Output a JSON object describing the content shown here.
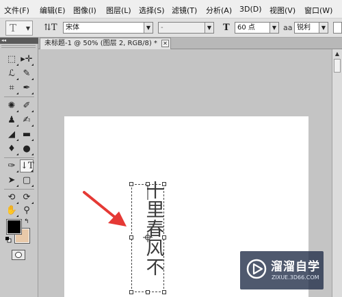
{
  "menu": {
    "items": [
      "文件(F)",
      "编辑(E)",
      "图像(I)",
      "图层(L)",
      "选择(S)",
      "滤镜(T)",
      "分析(A)",
      "3D(D)",
      "视图(V)",
      "窗口(W)"
    ]
  },
  "options": {
    "tool_preset_glyph": "T",
    "orientation_glyph": "⇅T",
    "font_family": "宋体",
    "font_style": "-",
    "size_glyph": "T",
    "font_size": "60 点",
    "aa_glyph": "aa",
    "antialias": "锐利"
  },
  "document": {
    "tab_title": "未标题-1 @ 50% (图层 2, RGB/8) *",
    "vertical_text": [
      "十",
      "里",
      "春",
      "风",
      "不"
    ]
  },
  "colors": {
    "foreground": "#000000",
    "background": "#e8c9a9",
    "arrow": "#e53935",
    "watermark_bg": "#28344e"
  },
  "watermark": {
    "name": "溜溜自学",
    "url": "ZIXUE.3D66.COM"
  }
}
